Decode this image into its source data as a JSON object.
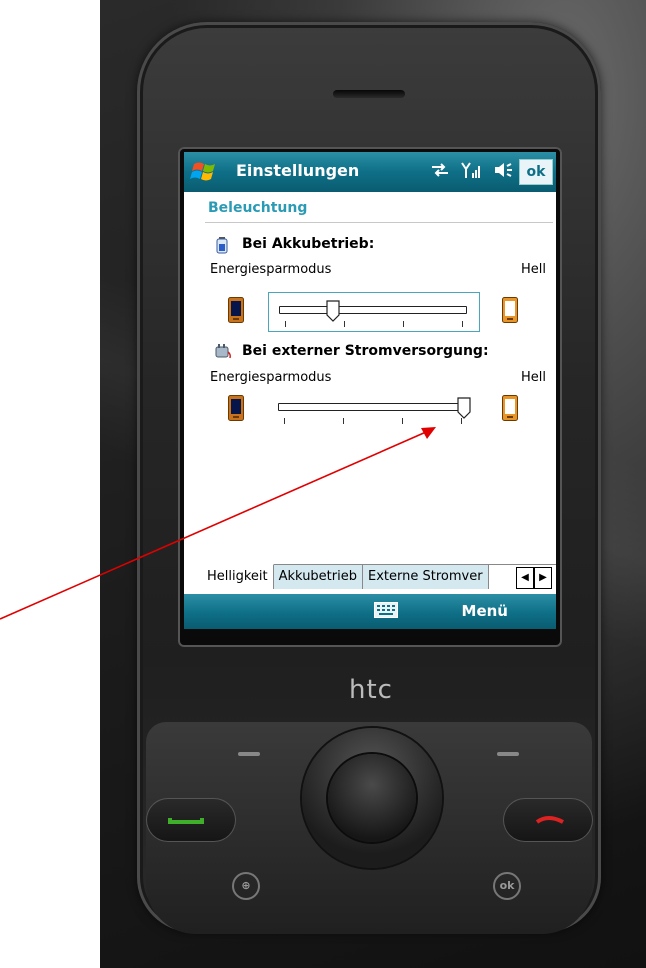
{
  "titlebar": {
    "title": "Einstellungen",
    "ok_label": "ok",
    "icons": [
      "windows-start-icon",
      "sync-icon",
      "signal-icon",
      "volume-icon"
    ]
  },
  "page": {
    "heading": "Beleuchtung"
  },
  "battery_section": {
    "title": "Bei Akkubetrieb:",
    "min_label": "Energiesparmodus",
    "max_label": "Hell",
    "level_fraction": 0.25
  },
  "external_section": {
    "title": "Bei externer Stromversorgung:",
    "min_label": "Energiesparmodus",
    "max_label": "Hell",
    "level_fraction": 1.0
  },
  "tabs": [
    {
      "label": "Helligkeit",
      "active": true
    },
    {
      "label": "Akkubetrieb",
      "active": false
    },
    {
      "label": "Externe Stromver",
      "active": false
    }
  ],
  "softkeys": {
    "right_label": "Menü"
  },
  "device": {
    "brand": "htc"
  },
  "colors": {
    "titlebar": "#0e6f87",
    "heading": "#2b9bb5",
    "annotation_arrow": "#e00000"
  }
}
